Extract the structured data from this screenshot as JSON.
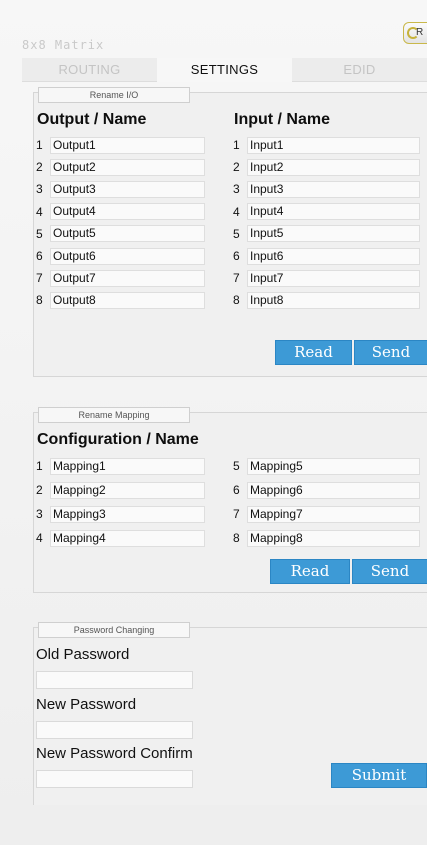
{
  "app": {
    "title": "8x8 Matrix",
    "refresh_label": "R"
  },
  "tabs": [
    {
      "label": "ROUTING",
      "active": false
    },
    {
      "label": "SETTINGS",
      "active": true
    },
    {
      "label": "EDID",
      "active": false
    }
  ],
  "rename_io": {
    "legend": "Rename I/O",
    "output_header": "Output / Name",
    "input_header": "Input / Name",
    "outputs": [
      {
        "num": "1",
        "value": "Output1"
      },
      {
        "num": "2",
        "value": "Output2"
      },
      {
        "num": "3",
        "value": "Output3"
      },
      {
        "num": "4",
        "value": "Output4"
      },
      {
        "num": "5",
        "value": "Output5"
      },
      {
        "num": "6",
        "value": "Output6"
      },
      {
        "num": "7",
        "value": "Output7"
      },
      {
        "num": "8",
        "value": "Output8"
      }
    ],
    "inputs": [
      {
        "num": "1",
        "value": "Input1"
      },
      {
        "num": "2",
        "value": "Input2"
      },
      {
        "num": "3",
        "value": "Input3"
      },
      {
        "num": "4",
        "value": "Input4"
      },
      {
        "num": "5",
        "value": "Input5"
      },
      {
        "num": "6",
        "value": "Input6"
      },
      {
        "num": "7",
        "value": "Input7"
      },
      {
        "num": "8",
        "value": "Input8"
      }
    ],
    "read_label": "Read",
    "send_label": "Send"
  },
  "rename_mapping": {
    "legend": "Rename Mapping",
    "header": "Configuration / Name",
    "left": [
      {
        "num": "1",
        "value": "Mapping1"
      },
      {
        "num": "2",
        "value": "Mapping2"
      },
      {
        "num": "3",
        "value": "Mapping3"
      },
      {
        "num": "4",
        "value": "Mapping4"
      }
    ],
    "right": [
      {
        "num": "5",
        "value": "Mapping5"
      },
      {
        "num": "6",
        "value": "Mapping6"
      },
      {
        "num": "7",
        "value": "Mapping7"
      },
      {
        "num": "8",
        "value": "Mapping8"
      }
    ],
    "read_label": "Read",
    "send_label": "Send"
  },
  "password": {
    "legend": "Password Changing",
    "old_label": "Old Password",
    "new_label": "New Password",
    "confirm_label": "New Password Confirm",
    "submit_label": "Submit"
  },
  "colors": {
    "accent": "#3d9ad6",
    "background": "#f3f3f3"
  }
}
